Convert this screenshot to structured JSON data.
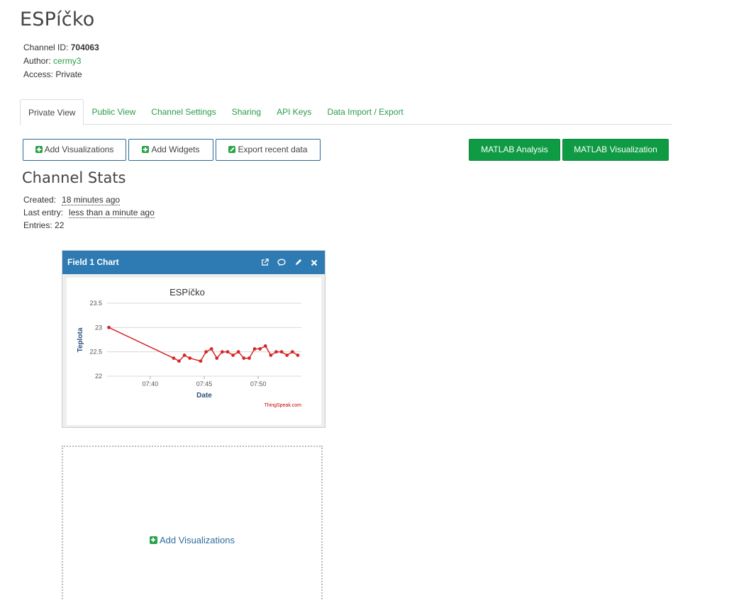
{
  "header": {
    "title": "ESPíčko"
  },
  "meta": {
    "channel_id_label": "Channel ID:",
    "channel_id": "704063",
    "author_label": "Author:",
    "author": "cermy3",
    "access_label": "Access:",
    "access": "Private"
  },
  "tabs": [
    {
      "label": "Private View",
      "active": true
    },
    {
      "label": "Public View"
    },
    {
      "label": "Channel Settings"
    },
    {
      "label": "Sharing"
    },
    {
      "label": "API Keys"
    },
    {
      "label": "Data Import / Export"
    }
  ],
  "toolbar": {
    "add_visualizations": "Add Visualizations",
    "add_widgets": "Add Widgets",
    "export_recent": "Export recent data",
    "matlab_analysis": "MATLAB Analysis",
    "matlab_visualization": "MATLAB Visualization"
  },
  "stats": {
    "title": "Channel Stats",
    "created_label": "Created:",
    "created": "18 minutes ago",
    "last_entry_label": "Last entry:",
    "last_entry": "less than a minute ago",
    "entries_label": "Entries:",
    "entries": "22"
  },
  "widget": {
    "title": "Field 1 Chart",
    "icons": [
      "external-link-icon",
      "comment-icon",
      "pencil-icon",
      "close-icon"
    ]
  },
  "chart_data": {
    "type": "line",
    "title": "ESPíčko",
    "xlabel": "Date",
    "ylabel": "Teplota",
    "credit": "ThingSpeak.com",
    "yticks": [
      "23.5",
      "23",
      "22.5",
      "22"
    ],
    "xticks": [
      "07:40",
      "07:45",
      "07:50"
    ],
    "ylim": [
      22,
      23.5
    ],
    "xlim": [
      "07:36",
      "07:54"
    ],
    "grid": true,
    "colors": {
      "line": "#d62728"
    },
    "x": [
      "07:36:10",
      "07:42:10",
      "07:42:40",
      "07:43:10",
      "07:43:40",
      "07:44:40",
      "07:45:10",
      "07:45:40",
      "07:46:10",
      "07:46:40",
      "07:47:10",
      "07:47:40",
      "07:48:10",
      "07:48:40",
      "07:49:10",
      "07:49:40",
      "07:50:10",
      "07:50:40",
      "07:51:10",
      "07:51:40",
      "07:52:10",
      "07:52:40",
      "07:53:10",
      "07:53:40"
    ],
    "values": [
      23.0,
      22.37,
      22.31,
      22.43,
      22.37,
      22.31,
      22.5,
      22.56,
      22.37,
      22.5,
      22.5,
      22.43,
      22.5,
      22.37,
      22.37,
      22.56,
      22.56,
      22.62,
      22.43,
      22.5,
      22.5,
      22.43,
      22.5,
      22.43
    ]
  },
  "empty_slot": {
    "add_label": "Add Visualizations"
  }
}
